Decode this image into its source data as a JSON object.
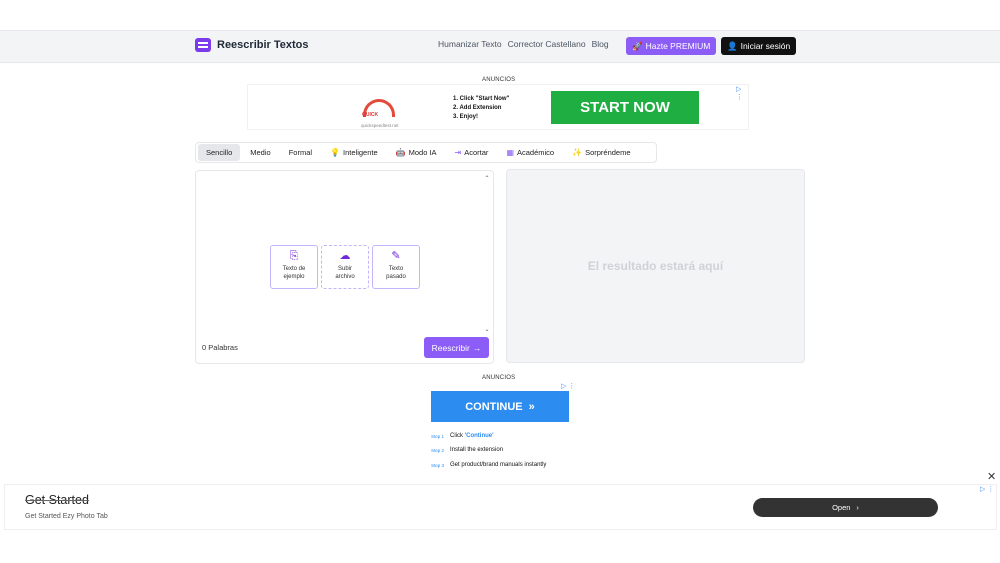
{
  "header": {
    "logo_text": "Reescribir Textos",
    "nav": [
      "Humanizar Texto",
      "Corrector Castellano",
      "Blog"
    ],
    "premium_label": "Hazte PREMIUM",
    "login_label": "Iniciar sesión"
  },
  "ad_top": {
    "label": "ANUNCIOS",
    "steps": [
      "1. Click \"Start Now\"",
      "2. Add Extension",
      "3. Enjoy!"
    ],
    "cta": "START NOW",
    "brand_url": "quickspeedtest.net",
    "brand_name": "QUICK"
  },
  "tabs": [
    {
      "label": "Sencillo",
      "icon": ""
    },
    {
      "label": "Medio",
      "icon": ""
    },
    {
      "label": "Formal",
      "icon": ""
    },
    {
      "label": "Inteligente",
      "icon": "lightbulb-icon"
    },
    {
      "label": "Modo IA",
      "icon": "robot-icon"
    },
    {
      "label": "Acortar",
      "icon": "shorten-icon"
    },
    {
      "label": "Académico",
      "icon": "calendar-icon"
    },
    {
      "label": "Sorpréndeme",
      "icon": "sparkle-icon"
    }
  ],
  "editor": {
    "options": [
      {
        "label_1": "Texto de",
        "label_2": "ejemplo",
        "icon": "document-import-icon"
      },
      {
        "label_1": "Subir",
        "label_2": "archivo",
        "icon": "cloud-upload-icon"
      },
      {
        "label_1": "Texto",
        "label_2": "pasado",
        "icon": "document-edit-icon"
      }
    ],
    "word_count": "0 Palabras",
    "rewrite_label": "Reescribir"
  },
  "result": {
    "placeholder": "El resultado estará aquí"
  },
  "ad_middle": {
    "label": "ANUNCIOS",
    "cta": "CONTINUE",
    "steps": [
      {
        "num": "Step 1",
        "text": "Click ",
        "highlight": "'Continue'"
      },
      {
        "num": "Step 2",
        "text": "Install the extension",
        "highlight": ""
      },
      {
        "num": "Step 3",
        "text": "Get product/brand manuals instantly",
        "highlight": ""
      }
    ]
  },
  "ad_bottom": {
    "title": "Get Started",
    "subtitle": "Get Started Ezy Photo Tab",
    "open_label": "Open"
  },
  "colors": {
    "accent": "#8b5cf6",
    "start_now": "#1fae42",
    "continue": "#2d8cf0"
  }
}
